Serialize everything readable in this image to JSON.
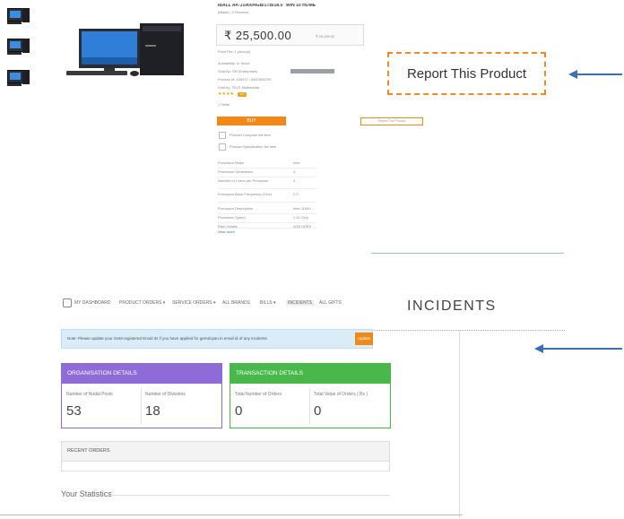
{
  "product": {
    "title": "IBALL AK-J1900/4GB/1TB/18.5\" WIN 10 HOME",
    "subtitle": "(Black) | 0 Reviews",
    "price": "₹ 25,500.00",
    "price_note": "₹ 29,000.00",
    "price_caption": "Price Per: 1 piece(s)",
    "specs": [
      "Availability: In Stock",
      "Sold By: SRI Enterprises",
      "Product Id: 100437 / 8907685700",
      "Sold by: TELE Multimedia"
    ],
    "rating": "★★★★",
    "rating_badge": "4.0",
    "reviews_link": "1 Seller",
    "buy_label": "BUY",
    "report_small_label": "Report This Product",
    "checkbox_items": [
      "Product Compare list item",
      "Product Specification list item"
    ],
    "table": [
      {
        "k": "Processor Make",
        "v": "Intel"
      },
      {
        "k": "Processor Generation",
        "v": "4"
      },
      {
        "k": "Number of Cores per Processor",
        "v": "4"
      },
      {
        "k": "Processor Base Frequency (GHz)",
        "v": "2.0"
      },
      {
        "k": "Processor Description",
        "v": "Intel J1900"
      },
      {
        "k": "Processor Speed",
        "v": "2.42 GHz"
      },
      {
        "k": "Ram Details",
        "v": "4GB DDR3"
      }
    ],
    "view_more": "View more"
  },
  "callouts": {
    "report_label": "Report This Product",
    "incidents_label": "INCIDENTS"
  },
  "dashboard": {
    "nav": [
      "MY DASHBOARD",
      "PRODUCT ORDERS ▾",
      "SERVICE ORDERS ▾",
      "ALL BRANDS",
      "BILLS ▾",
      "INCIDENTS",
      "ALL GIFTS"
    ],
    "note_text": "Note: Please update your GeM registered Email ID if you have applied for gemdoyan.in email id of any incidents",
    "note_button": "Update",
    "org": {
      "title": "ORGANISATION DETAILS",
      "left_label": "Number of Nodal Posts",
      "left_value": "53",
      "right_label": "Number of Divisions",
      "right_value": "18"
    },
    "txn": {
      "title": "TRANSACTION DETAILS",
      "left_label": "Total Number of Orders",
      "left_value": "0",
      "right_label": "Total Value of Orders ( Rs )",
      "right_value": "0"
    },
    "recent_orders": "RECENT ORDERS",
    "your_statistics": "Your Statistics"
  },
  "colors": {
    "accent_orange": "#f0891a",
    "org_purple": "#8e6bd6",
    "txn_green": "#48b84a",
    "arrow_blue": "#3b6fb8"
  }
}
